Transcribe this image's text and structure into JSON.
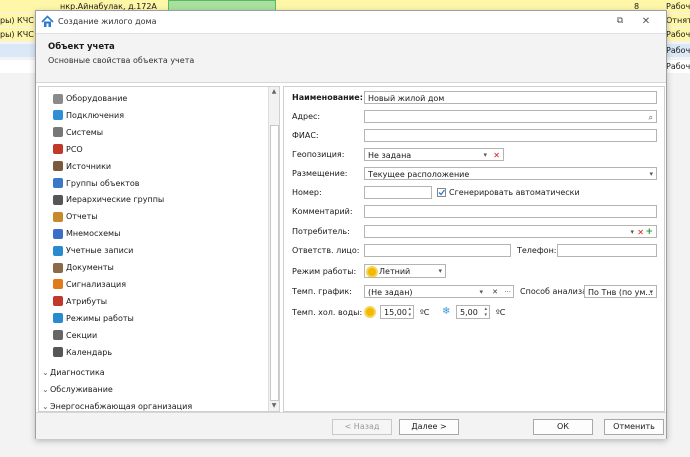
{
  "background": {
    "row1_address": "нкр.Айнабулак, д.172А",
    "row1_num": "8",
    "row1_status": "Рабочи",
    "row2_text": "ры) КЧС М",
    "row2_status": "Отнят н",
    "row3_text": "ры) КЧС М",
    "row3_status": "Рабочи",
    "row4_status": "Рабочи",
    "row5_status": "Рабочи"
  },
  "dialog": {
    "title": "Создание жилого дома",
    "header_title": "Объект учета",
    "header_subtitle": "Основные свойства объекта учета"
  },
  "sidebar": {
    "items": [
      {
        "label": "Оборудование",
        "icon": "equipment-icon",
        "color": "#8a8a8a"
      },
      {
        "label": "Подключения",
        "icon": "connections-icon",
        "color": "#2f8fd6"
      },
      {
        "label": "Системы",
        "icon": "systems-icon",
        "color": "#777777"
      },
      {
        "label": "РСО",
        "icon": "rso-icon",
        "color": "#c0392b"
      },
      {
        "label": "Источники",
        "icon": "sources-icon",
        "color": "#7a5a3a"
      },
      {
        "label": "Группы объектов",
        "icon": "object-groups-icon",
        "color": "#3a78c8"
      },
      {
        "label": "Иерархические группы",
        "icon": "hierarchy-groups-icon",
        "color": "#555555"
      },
      {
        "label": "Отчеты",
        "icon": "reports-icon",
        "color": "#c68a2a"
      },
      {
        "label": "Мнемосхемы",
        "icon": "mnemonic-icon",
        "color": "#3a6ec8"
      },
      {
        "label": "Учетные записи",
        "icon": "accounts-icon",
        "color": "#2a8ad0"
      },
      {
        "label": "Документы",
        "icon": "documents-icon",
        "color": "#8a6a4a"
      },
      {
        "label": "Сигнализация",
        "icon": "alarm-icon",
        "color": "#e07a1a"
      },
      {
        "label": "Атрибуты",
        "icon": "attributes-icon",
        "color": "#c0392b"
      },
      {
        "label": "Режимы работы",
        "icon": "work-modes-icon",
        "color": "#2a8ad0"
      },
      {
        "label": "Секции",
        "icon": "sections-icon",
        "color": "#666666"
      },
      {
        "label": "Календарь",
        "icon": "calendar-icon",
        "color": "#555555"
      }
    ],
    "groups": [
      "Диагностика",
      "Обслуживание",
      "Энергоснабжающая организация"
    ]
  },
  "form": {
    "name_label": "Наименование:",
    "name_value": "Новый жилой дом",
    "address_label": "Адрес:",
    "fias_label": "ФИАС:",
    "geo_label": "Геопозиция:",
    "geo_value": "Не задана",
    "placement_label": "Размещение:",
    "placement_value": "Текущее расположение",
    "number_label": "Номер:",
    "autogen_label": "Сгенерировать автоматически",
    "comment_label": "Комментарий:",
    "consumer_label": "Потребитель:",
    "responsible_label": "Ответств. лицо:",
    "phone_label": "Телефон:",
    "mode_label": "Режим работы:",
    "mode_value": "Летний",
    "temp_schedule_label": "Темп. график:",
    "temp_schedule_value": "(Не задан)",
    "analysis_label": "Способ анализа:",
    "analysis_value": "По Тнв (по ум...",
    "cold_water_label": "Темп. хол. воды:",
    "summer_temp": "15,00",
    "winter_temp": "5,00",
    "unit": "ºC"
  },
  "footer": {
    "back": "< Назад",
    "next": "Далее >",
    "ok": "ОК",
    "cancel": "Отменить"
  },
  "colors": {
    "accent_green": "#5cb85c",
    "highlight_yellow": "#fff7a8",
    "row_blue": "#dbe8f7"
  }
}
